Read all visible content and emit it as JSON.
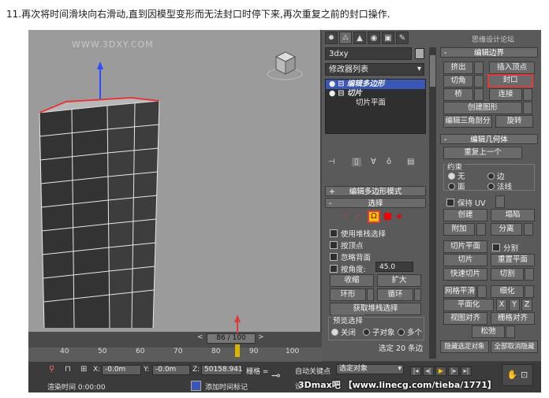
{
  "caption": "11.再次将时间滑块向右滑动,直到因模型变形而无法封口时停下来,再次重复之前的封口操作.",
  "viewport": {
    "watermark": "WWW.3DXY.COM"
  },
  "command_panel": {
    "tabs": [
      "✹",
      "⛼",
      "▲",
      "◉",
      "▣",
      "✎"
    ],
    "object_name": "3dxy",
    "modifier_list": "修改器列表",
    "stack": [
      {
        "label": "编辑多边形",
        "selected": true
      },
      {
        "label": "切片",
        "selected": false
      },
      {
        "label": "切片平面",
        "selected": false
      }
    ],
    "edit_poly_mode": {
      "header": "编辑多边形模式"
    },
    "selection": {
      "header": "选择",
      "use_stack": "使用堆栈选择",
      "by_vertex": "按顶点",
      "ignore_back": "忽略背面",
      "by_angle": "按角度:",
      "angle_value": "45.0",
      "shrink": "收缩",
      "grow": "扩大",
      "ring": "环形",
      "loop": "循环",
      "get_stack": "获取堆栈选择",
      "preview_label": "预览选择",
      "preview_off": "关闭",
      "preview_sub": "子对象",
      "preview_multi": "多个",
      "status": "选定 20 条边"
    },
    "edit_borders": {
      "header": "编辑边界",
      "extrude": "挤出",
      "insert_vertex": "插入顶点",
      "chamfer": "切角",
      "cap": "封口",
      "bridge": "桥",
      "connect": "连接",
      "create_shape": "创建图形",
      "edit_tri": "编辑三角剖分",
      "turn": "旋转"
    },
    "edit_geometry": {
      "header": "编辑几何体",
      "repeat_last": "重复上一个",
      "constraints": "约束",
      "c_none": "无",
      "c_edge": "边",
      "c_face": "面",
      "c_normal": "法线",
      "preserve_uv": "保持 UV",
      "create": "创建",
      "collapse": "塌陷",
      "attach": "附加",
      "detach": "分离",
      "slice_plane": "切片平面",
      "split": "分割",
      "slice": "切片",
      "reset_plane": "重置平面",
      "quickslice": "快速切片",
      "cut": "切割",
      "msmooth": "网格平滑",
      "tessellate": "细化",
      "make_planar": "平面化",
      "x": "X",
      "y": "Y",
      "z": "Z",
      "view_align": "视图对齐",
      "grid_align": "栅格对齐",
      "relax": "松弛",
      "hide_sel": "隐藏选定对象",
      "unhide_all": "全部取消隐藏"
    },
    "site_tag": "思缘设计论坛"
  },
  "timeline": {
    "slider": "86 / 100",
    "ticks": [
      "40",
      "50",
      "60",
      "70",
      "80",
      "90",
      "100"
    ]
  },
  "status_bar": {
    "x_label": "X:",
    "x_value": "-0.0m",
    "y_label": "Y:",
    "y_value": "-0.0m",
    "z_label": "Z:",
    "z_value": "50158.941",
    "grid_label": "栅格 =",
    "auto_key": "自动关键点",
    "selected_object": "选定对象",
    "set_key": "设",
    "render_time": "渲染时间 0:00:00",
    "add_time_tag": "添加时间标记"
  },
  "credit": "3Dmax吧 【www.linecg.com/tieba/1771】",
  "colors": {
    "highlight": "#e03a3a",
    "stack_select": "#3b57b5",
    "building_dark": "#333333"
  }
}
